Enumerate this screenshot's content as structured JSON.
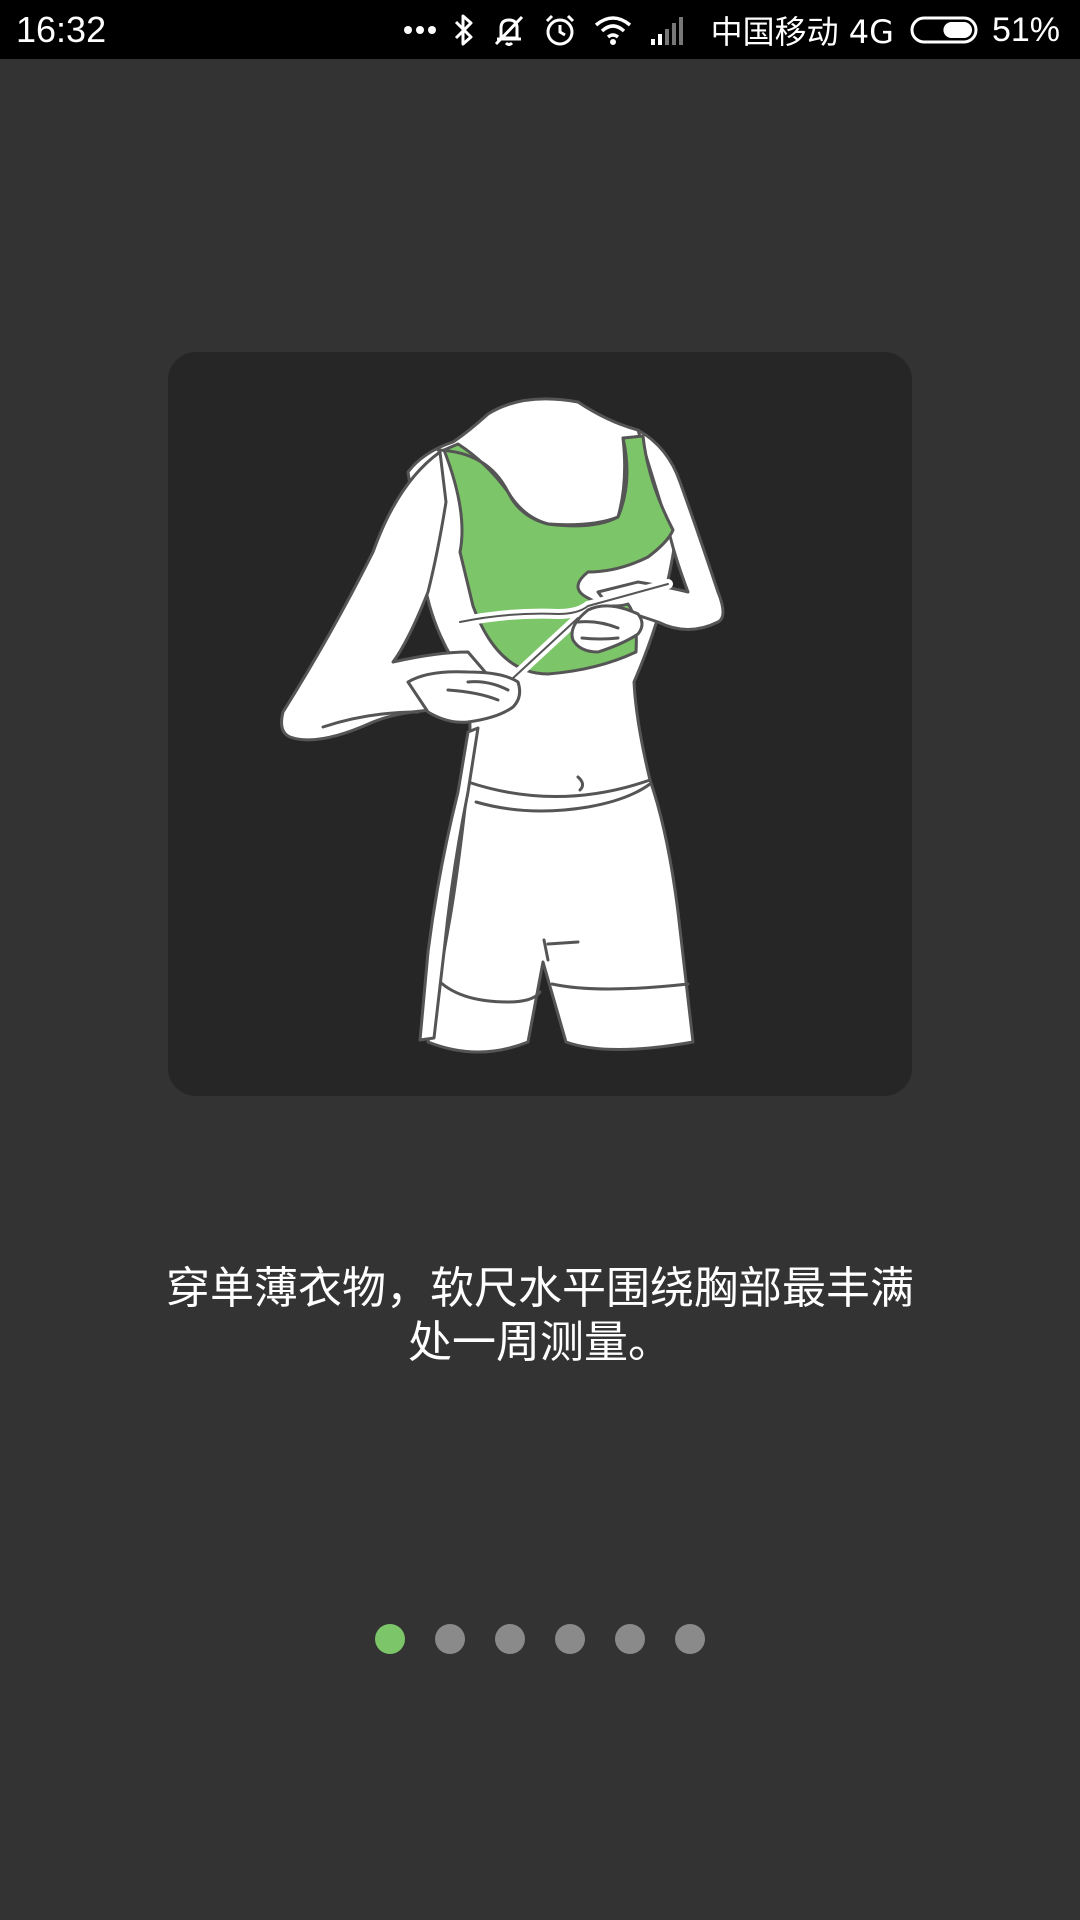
{
  "status_bar": {
    "time": "16:32",
    "carrier": "中国移动 4G",
    "battery_percent": "51%",
    "battery_level": 0.51,
    "icons": [
      "more-dots-icon",
      "bluetooth-icon",
      "vibrate-off-icon",
      "alarm-icon",
      "wifi-icon",
      "signal-icon",
      "battery-icon"
    ]
  },
  "illustration": {
    "icon": "chest-measurement-illustration"
  },
  "instruction": {
    "line1": "穿单薄衣物，软尺水平围绕胸部最丰满",
    "line2": "处一周测量。"
  },
  "pager": {
    "total": 6,
    "active_index": 0,
    "active_color": "#7cc568",
    "inactive_color": "#8a8a8a"
  },
  "colors": {
    "background": "#333333",
    "card": "#262626",
    "accent": "#7cc568"
  }
}
